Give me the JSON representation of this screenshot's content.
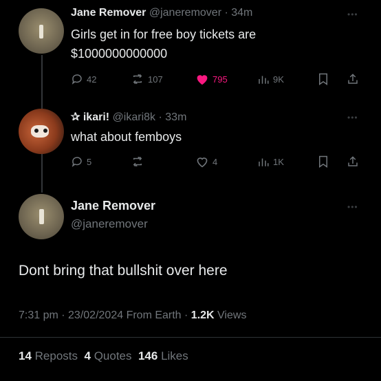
{
  "tweet1": {
    "name": "Jane Remover",
    "handle": "@janeremover",
    "time": "34m",
    "text_line1": "Girls get in for free boy tickets are",
    "text_line2": "$1000000000000",
    "replies": "42",
    "reposts": "107",
    "likes": "795",
    "views": "9K"
  },
  "tweet2": {
    "name": "ikari!",
    "name_prefix": "✰",
    "handle": "@ikari8k",
    "time": "33m",
    "text": "what about femboys",
    "replies": "5",
    "reposts": "",
    "likes": "4",
    "views": "1K"
  },
  "main": {
    "name": "Jane Remover",
    "handle": "@janeremover",
    "text": "Dont bring that bullshit over here",
    "time": "7:31 pm",
    "date": "23/02/2024",
    "source": "From Earth",
    "views_count": "1.2K",
    "views_label": "Views",
    "reposts_count": "14",
    "reposts_label": "Reposts",
    "quotes_count": "4",
    "quotes_label": "Quotes",
    "likes_count": "146",
    "likes_label": "Likes"
  },
  "colors": {
    "background": "#000000",
    "text": "#e7e9ea",
    "muted": "#71767b",
    "like": "#f91880"
  },
  "icons": [
    "reply-icon",
    "repost-icon",
    "heart-icon",
    "views-icon",
    "bookmark-icon",
    "share-icon",
    "more-icon"
  ]
}
